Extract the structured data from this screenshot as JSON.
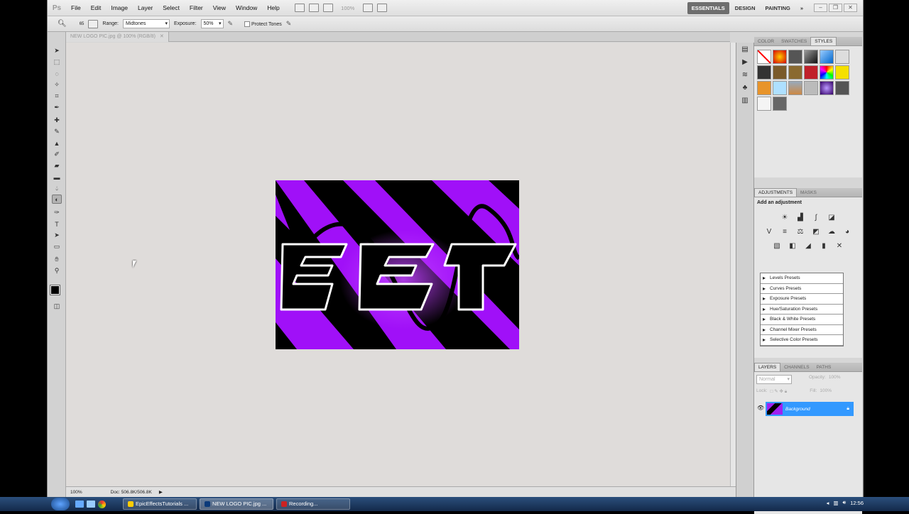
{
  "app": {
    "logo": "Ps"
  },
  "menu": [
    "File",
    "Edit",
    "Image",
    "Layer",
    "Select",
    "Filter",
    "View",
    "Window",
    "Help"
  ],
  "zoom_menu": "100%",
  "workspaces": [
    "ESSENTIALS",
    "DESIGN",
    "PAINTING"
  ],
  "options": {
    "brush_size": "65",
    "range_label": "Range:",
    "range_value": "Midtones",
    "exposure_label": "Exposure:",
    "exposure_value": "50%",
    "protect_tones": "Protect Tones"
  },
  "document": {
    "tab": "NEW LOGO PIC.jpg @ 100% (RGB/8)",
    "text": "EET"
  },
  "status": {
    "zoom": "100%",
    "doc": "Doc: 506.8K/506.8K"
  },
  "styles_panel": {
    "tabs": [
      "COLOR",
      "SWATCHES",
      "STYLES"
    ]
  },
  "adjustments_panel": {
    "tabs": [
      "ADJUSTMENTS",
      "MASKS"
    ],
    "title": "Add an adjustment",
    "presets": [
      "Levels Presets",
      "Curves Presets",
      "Exposure Presets",
      "Hue/Saturation Presets",
      "Black & White Presets",
      "Channel Mixer Presets",
      "Selective Color Presets"
    ]
  },
  "layers_panel": {
    "tabs": [
      "LAYERS",
      "CHANNELS",
      "PATHS"
    ],
    "blend": "Normal",
    "opacity_label": "Opacity:",
    "opacity": "100%",
    "lock_label": "Lock:",
    "fill_label": "Fill:",
    "fill": "100%",
    "layer_name": "Background"
  },
  "taskbar": {
    "items": [
      "EpicEffectsTutorials ...",
      "NEW LOGO PIC.jpg ...",
      "Recording..."
    ],
    "clock": "12:56"
  },
  "colors": {
    "accent_purple": "#a010f8",
    "layer_selected": "#3399ff",
    "essentials_active": "#6e6e6e"
  }
}
